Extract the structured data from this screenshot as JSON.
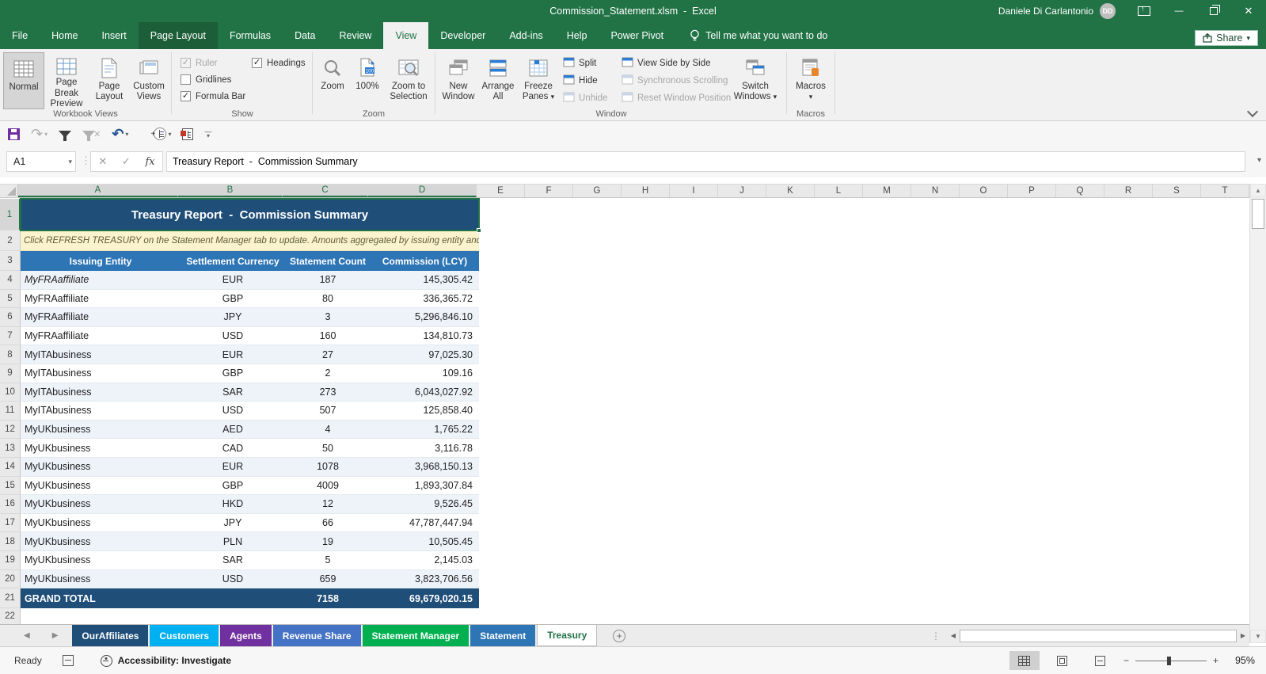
{
  "title_bar": {
    "title": "Commission_Statement.xlsm  -  Excel",
    "user_name": "Daniele Di Carlantonio",
    "user_initials": "DD"
  },
  "ribbon_tabs": [
    {
      "label": "File"
    },
    {
      "label": "Home"
    },
    {
      "label": "Insert"
    },
    {
      "label": "Page Layout",
      "highlight": true
    },
    {
      "label": "Formulas"
    },
    {
      "label": "Data"
    },
    {
      "label": "Review"
    },
    {
      "label": "View",
      "active": true
    },
    {
      "label": "Developer"
    },
    {
      "label": "Add-ins"
    },
    {
      "label": "Help"
    },
    {
      "label": "Power Pivot"
    }
  ],
  "tell_me": "Tell me what you want to do",
  "share_label": "Share",
  "ribbon": {
    "workbook_views": {
      "label": "Workbook Views",
      "buttons": [
        "Normal",
        "Page Break Preview",
        "Page Layout",
        "Custom Views"
      ]
    },
    "show": {
      "label": "Show",
      "items": [
        {
          "label": "Ruler",
          "checked": true,
          "disabled": true
        },
        {
          "label": "Gridlines",
          "checked": false,
          "disabled": false
        },
        {
          "label": "Formula Bar",
          "checked": true,
          "disabled": false
        },
        {
          "label": "Headings",
          "checked": true,
          "disabled": false
        }
      ]
    },
    "zoom": {
      "label": "Zoom",
      "buttons": [
        "Zoom",
        "100%",
        "Zoom to Selection"
      ]
    },
    "window": {
      "label": "Window",
      "big_buttons": [
        "New Window",
        "Arrange All",
        "Freeze Panes"
      ],
      "split_items": [
        {
          "label": "Split",
          "disabled": false
        },
        {
          "label": "Hide",
          "disabled": false
        },
        {
          "label": "Unhide",
          "disabled": true
        }
      ],
      "side_items": [
        {
          "label": "View Side by Side",
          "disabled": false
        },
        {
          "label": "Synchronous Scrolling",
          "disabled": true
        },
        {
          "label": "Reset Window Position",
          "disabled": true
        }
      ],
      "switch_button": "Switch Windows"
    },
    "macros": {
      "label": "Macros",
      "button": "Macros"
    }
  },
  "formula_bar": {
    "name_box": "A1",
    "formula": "Treasury Report  -  Commission Summary"
  },
  "sheet": {
    "columns": [
      "A",
      "B",
      "C",
      "D",
      "E",
      "F",
      "G",
      "H",
      "I",
      "J",
      "K",
      "L",
      "M",
      "N",
      "O",
      "P",
      "Q",
      "R",
      "S",
      "T"
    ],
    "selected_columns": [
      "A",
      "B",
      "C",
      "D"
    ],
    "title": "Treasury Report  -  Commission Summary",
    "note": "Click REFRESH TREASURY on the Statement Manager tab to update. Amounts aggregated by issuing entity and settlement currency",
    "headers": [
      "Issuing Entity",
      "Settlement Currency",
      "Statement Count",
      "Commission (LCY)"
    ],
    "rows": [
      {
        "entity": "MyFRAaffiliate",
        "currency": "EUR",
        "count": "187",
        "amount": "145,305.42",
        "italic": true
      },
      {
        "entity": "MyFRAaffiliate",
        "currency": "GBP",
        "count": "80",
        "amount": "336,365.72"
      },
      {
        "entity": "MyFRAaffiliate",
        "currency": "JPY",
        "count": "3",
        "amount": "5,296,846.10"
      },
      {
        "entity": "MyFRAaffiliate",
        "currency": "USD",
        "count": "160",
        "amount": "134,810.73"
      },
      {
        "entity": "MyITAbusiness",
        "currency": "EUR",
        "count": "27",
        "amount": "97,025.30"
      },
      {
        "entity": "MyITAbusiness",
        "currency": "GBP",
        "count": "2",
        "amount": "109.16"
      },
      {
        "entity": "MyITAbusiness",
        "currency": "SAR",
        "count": "273",
        "amount": "6,043,027.92"
      },
      {
        "entity": "MyITAbusiness",
        "currency": "USD",
        "count": "507",
        "amount": "125,858.40"
      },
      {
        "entity": "MyUKbusiness",
        "currency": "AED",
        "count": "4",
        "amount": "1,765.22"
      },
      {
        "entity": "MyUKbusiness",
        "currency": "CAD",
        "count": "50",
        "amount": "3,116.78"
      },
      {
        "entity": "MyUKbusiness",
        "currency": "EUR",
        "count": "1078",
        "amount": "3,968,150.13"
      },
      {
        "entity": "MyUKbusiness",
        "currency": "GBP",
        "count": "4009",
        "amount": "1,893,307.84"
      },
      {
        "entity": "MyUKbusiness",
        "currency": "HKD",
        "count": "12",
        "amount": "9,526.45"
      },
      {
        "entity": "MyUKbusiness",
        "currency": "JPY",
        "count": "66",
        "amount": "47,787,447.94"
      },
      {
        "entity": "MyUKbusiness",
        "currency": "PLN",
        "count": "19",
        "amount": "10,505.45"
      },
      {
        "entity": "MyUKbusiness",
        "currency": "SAR",
        "count": "5",
        "amount": "2,145.03"
      },
      {
        "entity": "MyUKbusiness",
        "currency": "USD",
        "count": "659",
        "amount": "3,823,706.56"
      }
    ],
    "grand_total": {
      "label": "GRAND TOTAL",
      "count": "7158",
      "amount": "69,679,020.15"
    }
  },
  "sheet_tabs": [
    {
      "label": "OurAffiliates",
      "color": "#1F4E79"
    },
    {
      "label": "Customers",
      "color": "#00B0F0"
    },
    {
      "label": "Agents",
      "color": "#7030A0"
    },
    {
      "label": "Revenue Share",
      "color": "#4472C4"
    },
    {
      "label": "Statement Manager",
      "color": "#00B050"
    },
    {
      "label": "Statement",
      "color": "#2E75B6"
    },
    {
      "label": "Treasury",
      "active": true
    }
  ],
  "status_bar": {
    "ready": "Ready",
    "accessibility": "Accessibility: Investigate",
    "zoom_level": "95%"
  },
  "icons": {
    "dropdown": "▾",
    "left_arrow": "◀",
    "right_arrow": "▶",
    "up_arrow": "▲",
    "down_arrow": "▼",
    "close": "✕",
    "check": "✓",
    "fx": "fx",
    "undo": "↶",
    "redo": "↷",
    "dots": "⋮",
    "plus": "+",
    "minus": "−",
    "dash": "—"
  },
  "colors": {
    "excel_green": "#217346",
    "title_fill": "#1F4E79",
    "header_fill": "#2E75B6",
    "band_fill": "#EEF3FA",
    "note_fill": "#FBF2CE",
    "note_text": "#5F5F33"
  }
}
